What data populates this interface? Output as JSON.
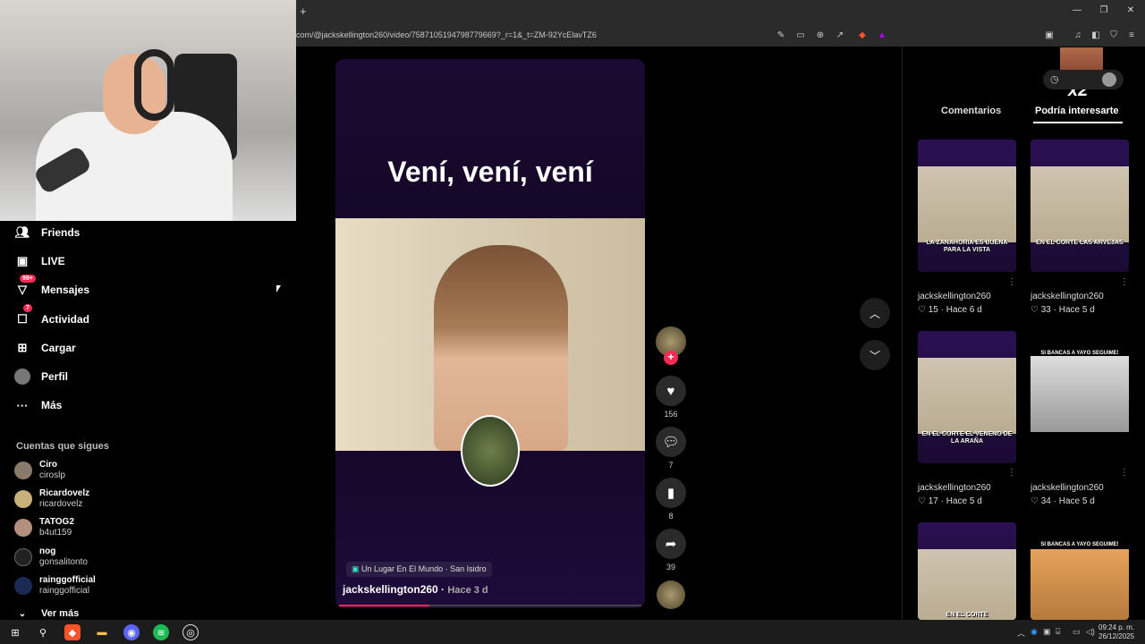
{
  "browser": {
    "url": "com/@jackskellington260/video/7587105194798779669?_r=1&_t=ZM-92YcElavTZ6",
    "new_tab_label": "+"
  },
  "sidebar": {
    "items": [
      {
        "label": "Friends",
        "icon": "friends-icon"
      },
      {
        "label": "LIVE",
        "icon": "live-icon"
      },
      {
        "label": "Mensajes",
        "icon": "messages-icon",
        "badge": "99+"
      },
      {
        "label": "Actividad",
        "icon": "activity-icon",
        "badge": "7"
      },
      {
        "label": "Cargar",
        "icon": "upload-icon"
      },
      {
        "label": "Perfil",
        "icon": "profile-icon"
      },
      {
        "label": "Más",
        "icon": "more-icon"
      }
    ],
    "following_title": "Cuentas que sigues",
    "following": [
      {
        "name": "Ciro",
        "handle": "ciroslp"
      },
      {
        "name": "Ricardovelz",
        "handle": "ricardovelz"
      },
      {
        "name": "TATOG2",
        "handle": "b4ut159"
      },
      {
        "name": "nog",
        "handle": "gonsalitonto"
      },
      {
        "name": "rainggofficial",
        "handle": "rainggofficial"
      }
    ],
    "see_more": "Ver más"
  },
  "video": {
    "caption_title": "Vení, vení, vení",
    "location": "Un Lugar En El Mundo · San Isidro",
    "author": "jackskellington260",
    "posted": "Hace 3 d",
    "progress": 0.3,
    "likes": "156",
    "comments": "7",
    "saves": "8",
    "shares": "39"
  },
  "right_panel": {
    "overlay_badge": "x2",
    "tabs": [
      "Comentarios",
      "Podría interesarte"
    ],
    "active_tab": 1,
    "suggestions": [
      {
        "user": "jackskellington260",
        "likes": "15",
        "age": "Hace 6 d",
        "caption": "LA ZANAHORIA ES BUENA PARA LA VISTA"
      },
      {
        "user": "jackskellington260",
        "likes": "33",
        "age": "Hace 5 d",
        "caption": "EN EL CORTE LAS ARVEJAS"
      },
      {
        "user": "jackskellington260",
        "likes": "17",
        "age": "Hace 5 d",
        "caption": "EN EL CORTE EL VENENO DE LA ARAÑA"
      },
      {
        "user": "jackskellington260",
        "likes": "34",
        "age": "Hace 5 d",
        "caption": "SI BANCAS A YAYO SEGUIME!"
      },
      {
        "caption": "EN EL CORTE"
      },
      {
        "caption": "SI BANCAS A YAYO SEGUIME!"
      }
    ]
  },
  "taskbar": {
    "time": "09:24 p. m.",
    "date": "26/12/2025"
  }
}
